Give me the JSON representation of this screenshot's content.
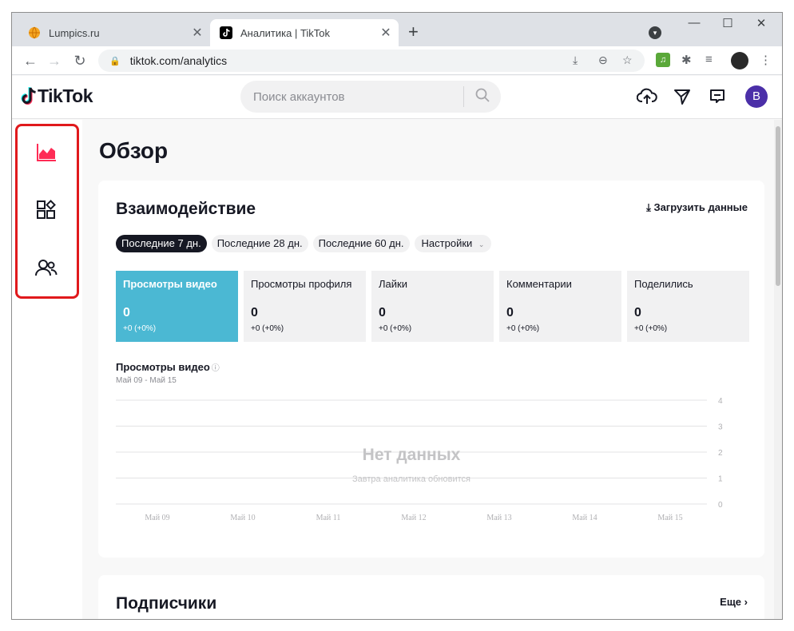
{
  "browser": {
    "tabs": [
      {
        "title": "Lumpics.ru",
        "close": "✕"
      },
      {
        "title": "Аналитика | TikTok",
        "close": "✕"
      }
    ],
    "new_tab": "+",
    "window_controls": {
      "minimize": "—",
      "maximize": "☐",
      "close": "✕"
    },
    "url": "tiktok.com/analytics"
  },
  "tiktok": {
    "logo": "TikTok",
    "search_placeholder": "Поиск аккаунтов",
    "avatar_letter": "B"
  },
  "page": {
    "title": "Обзор",
    "engagement": {
      "title": "Взаимодействие",
      "download": "Загрузить данные",
      "filters": [
        "Последние 7 дн.",
        "Последние 28 дн.",
        "Последние 60 дн."
      ],
      "settings": "Настройки",
      "metrics": [
        {
          "label": "Просмотры видео",
          "value": "0",
          "change": "+0 (+0%)"
        },
        {
          "label": "Просмотры профиля",
          "value": "0",
          "change": "+0 (+0%)"
        },
        {
          "label": "Лайки",
          "value": "0",
          "change": "+0 (+0%)"
        },
        {
          "label": "Комментарии",
          "value": "0",
          "change": "+0 (+0%)"
        },
        {
          "label": "Поделились",
          "value": "0",
          "change": "+0 (+0%)"
        }
      ]
    },
    "chart": {
      "title": "Просмотры видео",
      "range": "Май 09 - Май 15",
      "no_data": "Нет данных",
      "no_data_sub": "Завтра аналитика обновится"
    },
    "followers": {
      "title": "Подписчики",
      "more": "Еще"
    }
  },
  "chart_data": {
    "type": "line",
    "categories": [
      "Май 09",
      "Май 10",
      "Май 11",
      "Май 12",
      "Май 13",
      "Май 14",
      "Май 15"
    ],
    "series": [],
    "yticks": [
      "4",
      "3",
      "2",
      "1",
      "0"
    ],
    "ylim": [
      0,
      4
    ],
    "grid": true
  }
}
